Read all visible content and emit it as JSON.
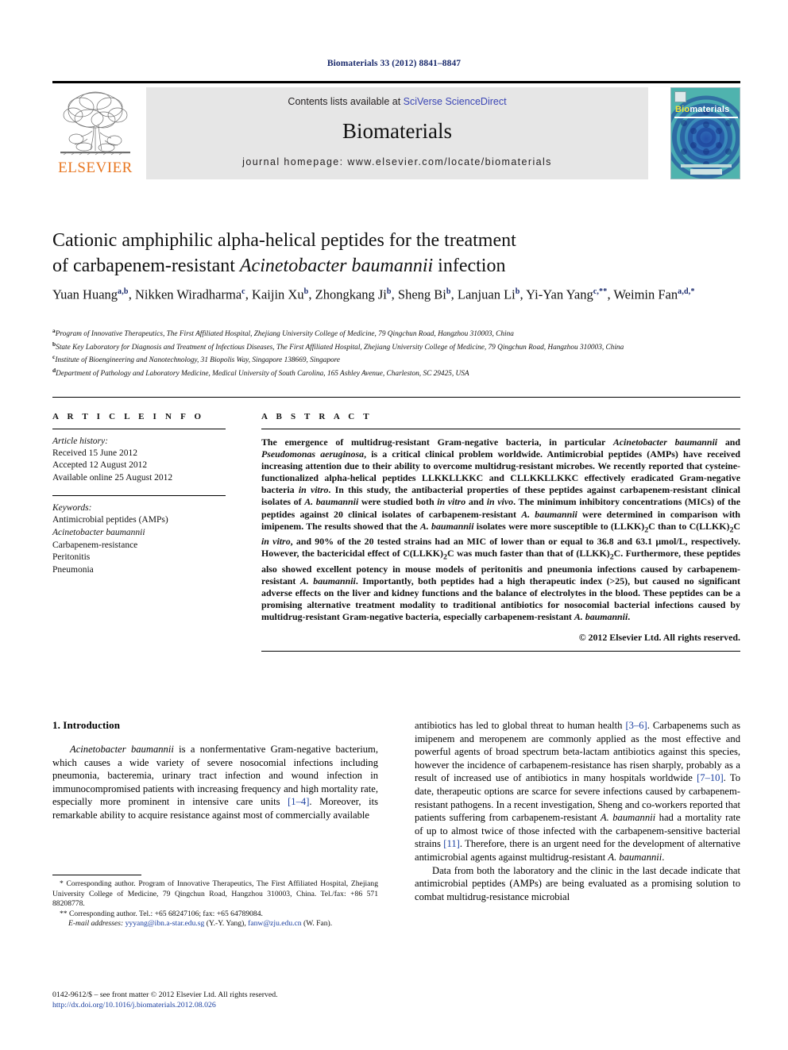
{
  "running_head": "Biomaterials 33 (2012) 8841–8847",
  "masthead": {
    "contents_prefix": "Contents lists available at ",
    "contents_link": "SciVerse ScienceDirect",
    "journal_title": "Biomaterials",
    "journal_homepage": "journal homepage: www.elsevier.com/locate/biomaterials",
    "publisher_wordmark": "ELSEVIER",
    "cover_title_part1": "Bio",
    "cover_title_part2": "materials",
    "link_color": "#3b46b5",
    "banner_bg": "#e6e6e6",
    "elsevier_orange": "#E87722",
    "cover_teal": "#49b0ad"
  },
  "article": {
    "title_line1": "Cationic amphiphilic alpha-helical peptides for the treatment",
    "title_line2_pre": "of carbapenem-resistant ",
    "title_line2_italic": "Acinetobacter baumannii",
    "title_line2_post": " infection",
    "authors": [
      {
        "name": "Yuan Huang",
        "sup": "a,b",
        "sep": ", "
      },
      {
        "name": "Nikken Wiradharma",
        "sup": "c",
        "sep": ", "
      },
      {
        "name": "Kaijin Xu",
        "sup": "b",
        "sep": ", "
      },
      {
        "name": "Zhongkang Ji",
        "sup": "b",
        "sep": ", "
      },
      {
        "name": "Sheng Bi",
        "sup": "b",
        "sep": ", "
      },
      {
        "name": "Lanjuan Li",
        "sup": "b",
        "sep": ", "
      },
      {
        "name": "Yi-Yan Yang",
        "sup": "c,**",
        "sep": ", "
      },
      {
        "name": "Weimin Fan",
        "sup": "a,d,*",
        "sep": ""
      }
    ],
    "affiliations": [
      {
        "mark": "a",
        "text": "Program of Innovative Therapeutics, The First Affiliated Hospital, Zhejiang University College of Medicine, 79 Qingchun Road, Hangzhou 310003, China"
      },
      {
        "mark": "b",
        "text": "State Key Laboratory for Diagnosis and Treatment of Infectious Diseases, The First Affiliated Hospital, Zhejiang University College of Medicine, 79 Qingchun Road, Hangzhou 310003, China"
      },
      {
        "mark": "c",
        "text": "Institute of Bioengineering and Nanotechnology, 31 Biopolis Way, Singapore 138669, Singapore"
      },
      {
        "mark": "d",
        "text": "Department of Pathology and Laboratory Medicine, Medical University of South Carolina, 165 Ashley Avenue, Charleston, SC 29425, USA"
      }
    ]
  },
  "article_info": {
    "heading": "A R T I C L E   I N F O",
    "history_label": "Article history:",
    "history": [
      "Received 15 June 2012",
      "Accepted 12 August 2012",
      "Available online 25 August 2012"
    ],
    "keywords_label": "Keywords:",
    "keywords": [
      "Antimicrobial peptides (AMPs)",
      "Acinetobacter baumannii",
      "Carbapenem-resistance",
      "Peritonitis",
      "Pneumonia"
    ],
    "keyword_italic_index": 1
  },
  "abstract": {
    "heading": "A B S T R A C T",
    "paragraph": "The emergence of multidrug-resistant Gram-negative bacteria, in particular Acinetobacter baumannii and Pseudomonas aeruginosa, is a critical clinical problem worldwide. Antimicrobial peptides (AMPs) have received increasing attention due to their ability to overcome multidrug-resistant microbes. We recently reported that cysteine-functionalized alpha-helical peptides LLKKLLKKC and CLLKKLLKKC effectively eradicated Gram-negative bacteria in vitro. In this study, the antibacterial properties of these peptides against carbapenem-resistant clinical isolates of A. baumannii were studied both in vitro and in vivo. The minimum inhibitory concentrations (MICs) of the peptides against 20 clinical isolates of carbapenem-resistant A. baumannii were determined in comparison with imipenem. The results showed that the A. baumannii isolates were more susceptible to (LLKK)2C than to C(LLKK)2C in vitro, and 90% of the 20 tested strains had an MIC of lower than or equal to 36.8 and 63.1 µmol/L, respectively. However, the bactericidal effect of C(LLKK)2C was much faster than that of (LLKK)2C. Furthermore, these peptides also showed excellent potency in mouse models of peritonitis and pneumonia infections caused by carbapenem-resistant A. baumannii. Importantly, both peptides had a high therapeutic index (>25), but caused no significant adverse effects on the liver and kidney functions and the balance of electrolytes in the blood. These peptides can be a promising alternative treatment modality to traditional antibiotics for nosocomial bacterial infections caused by multidrug-resistant Gram-negative bacteria, especially carbapenem-resistant A. baumannii.",
    "copyright": "© 2012 Elsevier Ltd. All rights reserved."
  },
  "introduction": {
    "heading": "1. Introduction",
    "left_paragraph": "Acinetobacter baumannii is a nonfermentative Gram-negative bacterium, which causes a wide variety of severe nosocomial infections including pneumonia, bacteremia, urinary tract infection and wound infection in immunocompromised patients with increasing frequency and high mortality rate, especially more prominent in intensive care units [1–4]. Moreover, its remarkable ability to acquire resistance against most of commercially available",
    "right_paragraph_1": "antibiotics has led to global threat to human health [3–6]. Carbapenems such as imipenem and meropenem are commonly applied as the most effective and powerful agents of broad spectrum beta-lactam antibiotics against this species, however the incidence of carbapenem-resistance has risen sharply, probably as a result of increased use of antibiotics in many hospitals worldwide [7–10]. To date, therapeutic options are scarce for severe infections caused by carbapenem-resistant pathogens. In a recent investigation, Sheng and co-workers reported that patients suffering from carbapenem-resistant A. baumannii had a mortality rate of up to almost twice of those infected with the carbapenem-sensitive bacterial strains [11]. Therefore, there is an urgent need for the development of alternative antimicrobial agents against multidrug-resistant A. baumannii.",
    "right_paragraph_2": "Data from both the laboratory and the clinic in the last decade indicate that antimicrobial peptides (AMPs) are being evaluated as a promising solution to combat multidrug-resistance microbial"
  },
  "footnotes": {
    "note1": "* Corresponding author. Program of Innovative Therapeutics, The First Affiliated Hospital, Zhejiang University College of Medicine, 79 Qingchun Road, Hangzhou 310003, China. Tel./fax: +86 571 88208778.",
    "note2": "** Corresponding author. Tel.: +65 68247106; fax: +65 64789084.",
    "email_label": "E-mail addresses:",
    "email1": "yyyang@ibn.a-star.edu.sg",
    "email1_owner": "(Y.-Y. Yang),",
    "email2": "fanw@zju.edu.cn",
    "email2_owner": "(W. Fan).",
    "issn_line": "0142-9612/$ – see front matter © 2012 Elsevier Ltd. All rights reserved.",
    "doi_line": "http://dx.doi.org/10.1016/j.biomaterials.2012.08.026"
  }
}
